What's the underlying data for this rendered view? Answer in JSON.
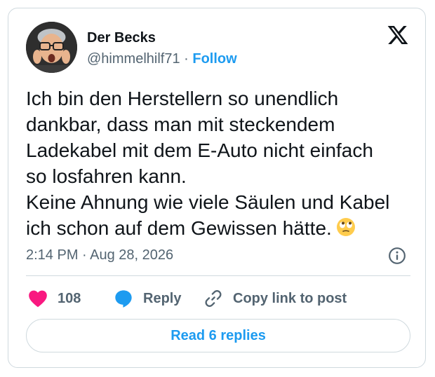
{
  "author": {
    "name": "Der Becks",
    "handle": "@himmelhilf71",
    "separator": " · ",
    "follow_label": "Follow"
  },
  "tweet": {
    "text": "Ich bin den Herstellern so unendlich\ndankbar, dass man mit steckendem\nLadekabel mit dem E-Auto nicht einfach\nso losfahren kann.\nKeine Ahnung wie viele Säulen und Kabel\nich schon auf dem Gewissen hätte.",
    "emoji": "face-with-rolling-eyes-icon",
    "time": "2:14 PM",
    "date_separator": " · ",
    "date": "Aug 28, 2026"
  },
  "actions": {
    "like_count": "108",
    "reply_label": "Reply",
    "copy_label": "Copy link to post"
  },
  "footer": {
    "read_replies_label": "Read 6 replies"
  },
  "colors": {
    "accent": "#1d9bf0",
    "like": "#f91880",
    "muted": "#536471",
    "border": "#cfd9de"
  },
  "icons": [
    "x-logo-icon",
    "info-icon",
    "heart-icon",
    "reply-bubble-icon",
    "link-icon"
  ]
}
